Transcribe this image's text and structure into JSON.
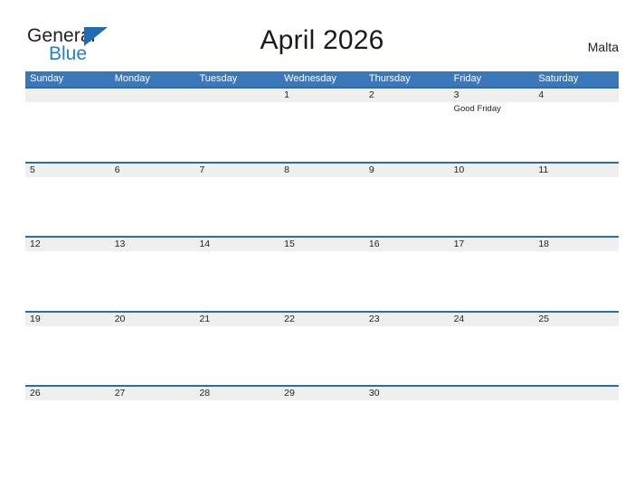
{
  "brand": {
    "name_part1": "General",
    "name_part2": "Blue",
    "triangle_color": "#1f6cb4",
    "blue_text_color": "#1f7fd4"
  },
  "header": {
    "title": "April 2026",
    "region": "Malta"
  },
  "theme": {
    "header_blue": "#3b77bb",
    "row_divider_blue": "#2e6da4",
    "band_gray": "#efefef",
    "text_color": "#231f20",
    "background": "#ffffff"
  },
  "calendar": {
    "month": "April",
    "year": "2026",
    "week_start": "Sunday",
    "weekdays": [
      "Sunday",
      "Monday",
      "Tuesday",
      "Wednesday",
      "Thursday",
      "Friday",
      "Saturday"
    ],
    "weeks": [
      [
        {
          "day": "",
          "events": []
        },
        {
          "day": "",
          "events": []
        },
        {
          "day": "",
          "events": []
        },
        {
          "day": "1",
          "events": []
        },
        {
          "day": "2",
          "events": []
        },
        {
          "day": "3",
          "events": [
            "Good Friday"
          ]
        },
        {
          "day": "4",
          "events": []
        }
      ],
      [
        {
          "day": "5",
          "events": []
        },
        {
          "day": "6",
          "events": []
        },
        {
          "day": "7",
          "events": []
        },
        {
          "day": "8",
          "events": []
        },
        {
          "day": "9",
          "events": []
        },
        {
          "day": "10",
          "events": []
        },
        {
          "day": "11",
          "events": []
        }
      ],
      [
        {
          "day": "12",
          "events": []
        },
        {
          "day": "13",
          "events": []
        },
        {
          "day": "14",
          "events": []
        },
        {
          "day": "15",
          "events": []
        },
        {
          "day": "16",
          "events": []
        },
        {
          "day": "17",
          "events": []
        },
        {
          "day": "18",
          "events": []
        }
      ],
      [
        {
          "day": "19",
          "events": []
        },
        {
          "day": "20",
          "events": []
        },
        {
          "day": "21",
          "events": []
        },
        {
          "day": "22",
          "events": []
        },
        {
          "day": "23",
          "events": []
        },
        {
          "day": "24",
          "events": []
        },
        {
          "day": "25",
          "events": []
        }
      ],
      [
        {
          "day": "26",
          "events": []
        },
        {
          "day": "27",
          "events": []
        },
        {
          "day": "28",
          "events": []
        },
        {
          "day": "29",
          "events": []
        },
        {
          "day": "30",
          "events": []
        },
        {
          "day": "",
          "events": []
        },
        {
          "day": "",
          "events": []
        }
      ]
    ]
  }
}
